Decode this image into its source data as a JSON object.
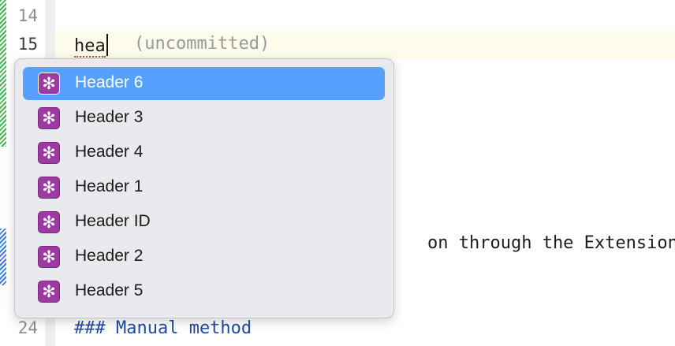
{
  "editor": {
    "line_numbers": {
      "l14": "14",
      "l15": "15",
      "l24": "24"
    },
    "typed_text": "hea",
    "inline_annotation": "(uncommitted)",
    "visible_code_right": "on through the Extension",
    "manual_heading": "### Manual method"
  },
  "completion": {
    "symbol_glyph": "✻",
    "selected_index": 0,
    "items": [
      {
        "label": "Header 6"
      },
      {
        "label": "Header 3"
      },
      {
        "label": "Header 4"
      },
      {
        "label": "Header 1"
      },
      {
        "label": "Header ID"
      },
      {
        "label": "Header 2"
      },
      {
        "label": "Header 5"
      }
    ]
  },
  "colors": {
    "selection": "#56a0ff",
    "symbol_badge": "#9b3aa0",
    "added_change": "#3fb950",
    "modified_change": "#3d7bf0",
    "heading_text": "#1f4aa8"
  }
}
